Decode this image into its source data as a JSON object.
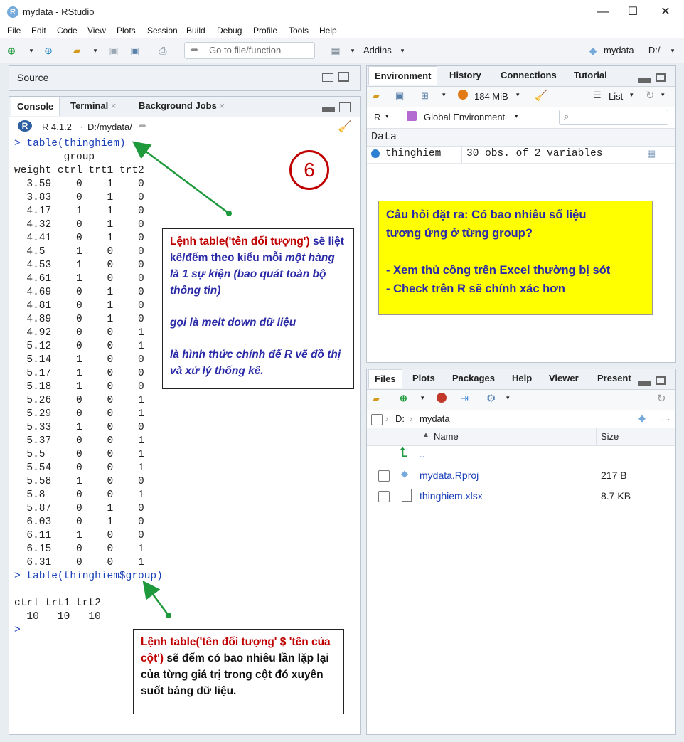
{
  "window": {
    "title": "mydata - RStudio"
  },
  "menu": [
    "File",
    "Edit",
    "Code",
    "View",
    "Plots",
    "Session",
    "Build",
    "Debug",
    "Profile",
    "Tools",
    "Help"
  ],
  "toolbar": {
    "goto_placeholder": "Go to file/function",
    "addins": "Addins",
    "project": "mydata — D:/"
  },
  "source_pane": {
    "title": "Source"
  },
  "console_tabs": {
    "console": "Console",
    "terminal": "Terminal",
    "background": "Background Jobs"
  },
  "console_path": {
    "version": "R 4.1.2",
    "sep": "·",
    "dir": "D:/mydata/"
  },
  "console": {
    "cmd1": "> table(thinghiem)",
    "header1": "        group",
    "header2": "weight ctrl trt1 trt2",
    "rows": [
      "  3.59    0    1    0",
      "  3.83    0    1    0",
      "  4.17    1    1    0",
      "  4.32    0    1    0",
      "  4.41    0    1    0",
      "  4.5     1    0    0",
      "  4.53    1    0    0",
      "  4.61    1    0    0",
      "  4.69    0    1    0",
      "  4.81    0    1    0",
      "  4.89    0    1    0",
      "  4.92    0    0    1",
      "  5.12    0    0    1",
      "  5.14    1    0    0",
      "  5.17    1    0    0",
      "  5.18    1    0    0",
      "  5.26    0    0    1",
      "  5.29    0    0    1",
      "  5.33    1    0    0",
      "  5.37    0    0    1",
      "  5.5     0    0    1",
      "  5.54    0    0    1",
      "  5.58    1    0    0",
      "  5.8     0    0    1",
      "  5.87    0    1    0",
      "  6.03    0    1    0",
      "  6.11    1    0    0",
      "  6.15    0    0    1",
      "  6.31    0    0    1"
    ],
    "cmd2": "> table(thinghiem$group)",
    "out2_header": "ctrl trt1 trt2",
    "out2_values": "  10   10   10",
    "prompt": ">"
  },
  "env_tabs": {
    "environment": "Environment",
    "history": "History",
    "connections": "Connections",
    "tutorial": "Tutorial"
  },
  "env_toolbar": {
    "memory": "184 MiB",
    "list": "List",
    "lang": "R",
    "scope": "Global Environment"
  },
  "env_data": {
    "section": "Data",
    "name": "thinghiem",
    "desc": "30 obs. of 2 variables"
  },
  "files_tabs": {
    "files": "Files",
    "plots": "Plots",
    "packages": "Packages",
    "help": "Help",
    "viewer": "Viewer",
    "present": "Present"
  },
  "files_path": {
    "drive": "D:",
    "folder": "mydata"
  },
  "files_columns": {
    "name": "Name",
    "size": "Size"
  },
  "files": [
    {
      "name": "..",
      "size": ""
    },
    {
      "name": "mydata.Rproj",
      "size": "217 B"
    },
    {
      "name": "thinghiem.xlsx",
      "size": "8.7 KB"
    }
  ],
  "step_number": "6",
  "annotation1": {
    "p1_red": "Lệnh table('tên đối tượng') ",
    "p1_black": "sẽ liệt kê/đếm theo kiểu mỗi ",
    "p1_italic": "một hàng là 1 sự kiện (bao quát toàn bộ thông tin)",
    "p2": "gọi là melt down dữ liệu",
    "p3": "là hình thức chính để R vẽ đồ thị và xử lý thống kê."
  },
  "annotation2": {
    "red": "Lệnh table('tên đối tượng' $ 'tên của cột') ",
    "black": "sẽ  đếm có bao nhiêu lần lặp lại của từng giá trị trong cột đó xuyên suốt bảng dữ liệu."
  },
  "question_box": {
    "line1": "Câu hỏi đặt ra: Có bao nhiêu số liệu",
    "line2": "tương ứng ở từng group?",
    "line3": "- Xem thủ công trên Excel thường bị sót",
    "line4": "- Check trên R sẽ chính xác hơn"
  },
  "colors": {
    "annotation_red": "#c00000",
    "annotation_navy": "#2a2aa8",
    "arrow_green": "#1e9a3c",
    "highlight": "#ffff00",
    "console_blue": "#1a40b8"
  }
}
